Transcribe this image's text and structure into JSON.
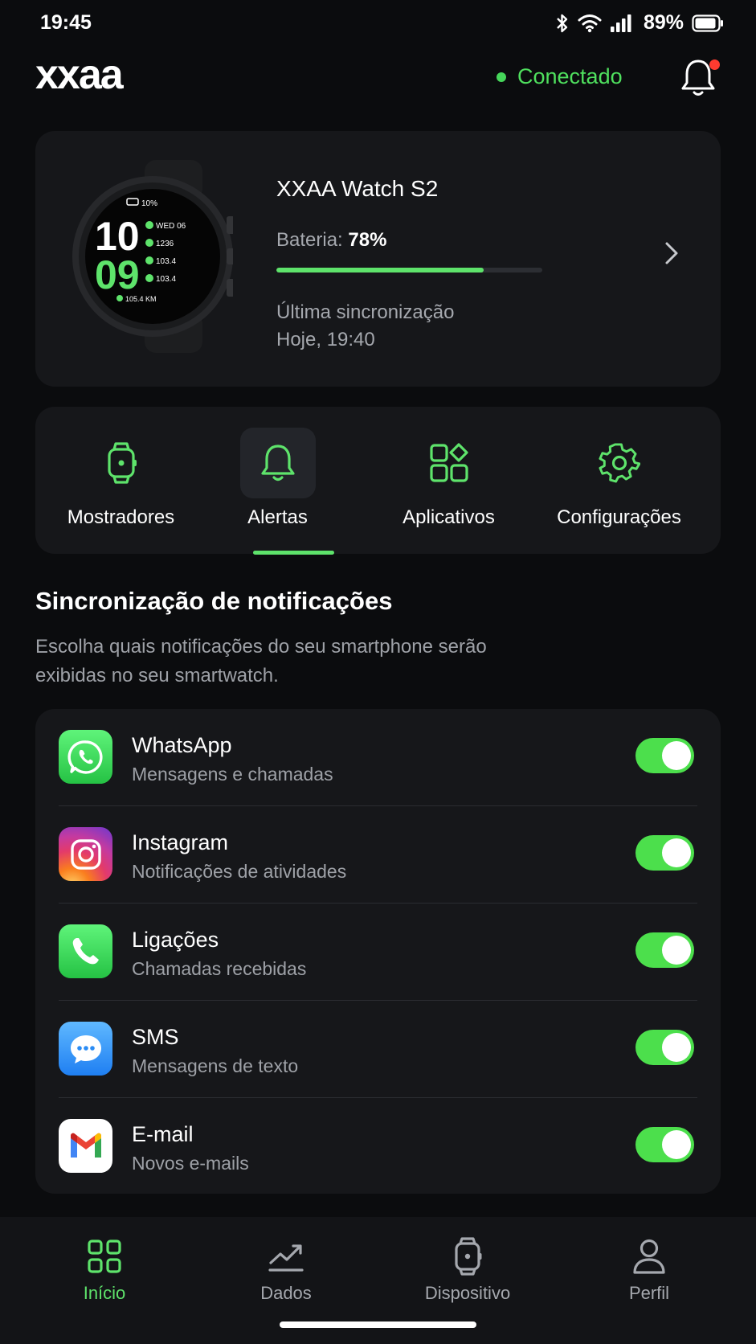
{
  "status_bar": {
    "time": "19:45",
    "battery": "89%"
  },
  "header": {
    "logo": "xxaa",
    "connection": "Conectado"
  },
  "device": {
    "name": "XXAA Watch S2",
    "battery_label": "Bateria:",
    "battery_value": "78%",
    "battery_level": 0.78,
    "sync_label": "Última sincronização",
    "sync_value": "Hoje, 19:40",
    "watch_face": {
      "battery": "10%",
      "hour": "10",
      "minute": "09",
      "date": "WED 06",
      "stat1": "1236",
      "stat2": "103.4",
      "stat3": "103.4",
      "distance": "105.4 KM"
    }
  },
  "tabs": [
    {
      "label": "Mostradores",
      "icon": "watch-icon",
      "active": false
    },
    {
      "label": "Alertas",
      "icon": "bell-icon",
      "active": true
    },
    {
      "label": "Aplicativos",
      "icon": "apps-icon",
      "active": false
    },
    {
      "label": "Configurações",
      "icon": "gear-icon",
      "active": false
    }
  ],
  "section": {
    "title": "Sincronização de notificações",
    "description": "Escolha quais notificações do seu smartphone serão exibidas no seu smartwatch."
  },
  "apps": [
    {
      "title": "WhatsApp",
      "subtitle": "Mensagens e chamadas",
      "icon": "whatsapp-icon",
      "enabled": true
    },
    {
      "title": "Instagram",
      "subtitle": "Notificações de atividades",
      "icon": "instagram-icon",
      "enabled": true
    },
    {
      "title": "Ligações",
      "subtitle": "Chamadas recebidas",
      "icon": "phone-icon",
      "enabled": true
    },
    {
      "title": "SMS",
      "subtitle": "Mensagens de texto",
      "icon": "sms-icon",
      "enabled": true
    },
    {
      "title": "E-mail",
      "subtitle": "Novos e-mails",
      "icon": "gmail-icon",
      "enabled": true
    }
  ],
  "bottom_nav": [
    {
      "label": "Início",
      "icon": "home-grid-icon",
      "active": true
    },
    {
      "label": "Dados",
      "icon": "chart-icon",
      "active": false
    },
    {
      "label": "Dispositivo",
      "icon": "watch-icon",
      "active": false
    },
    {
      "label": "Perfil",
      "icon": "user-icon",
      "active": false
    }
  ],
  "colors": {
    "accent": "#5ee36b",
    "toggle_on": "#4cdf4c",
    "background": "#0b0c0e",
    "card": "#16171a",
    "notification_badge": "#ff3b30"
  }
}
